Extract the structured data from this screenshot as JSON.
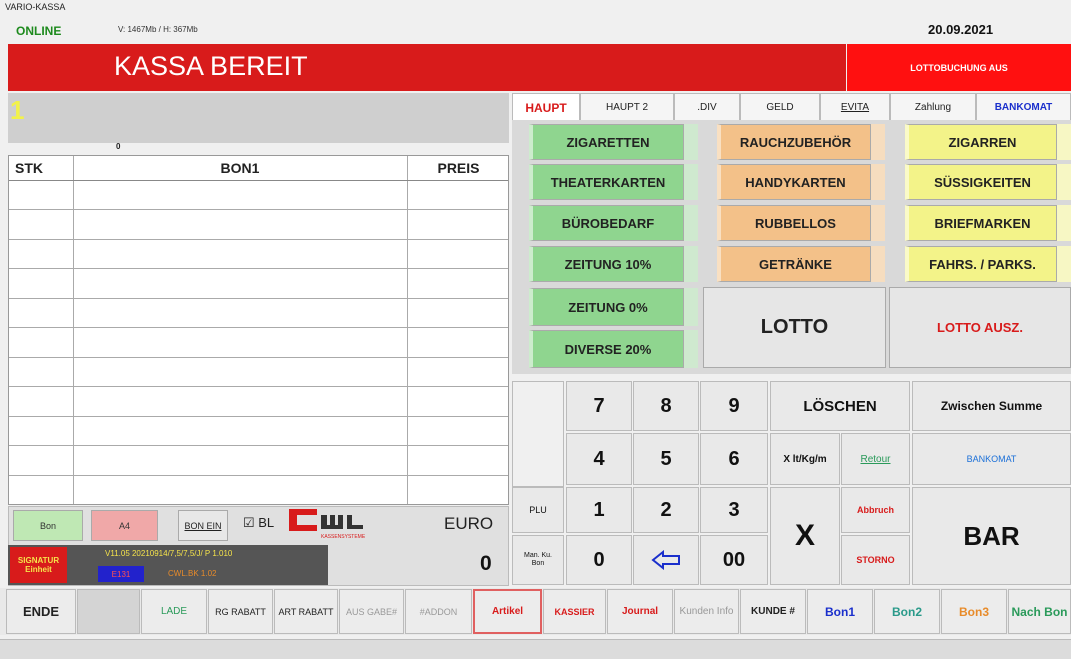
{
  "header": {
    "app_title": "VARIO-KASSA",
    "status": "ONLINE",
    "memory": "V: 1467Mb / H: 367Mb",
    "date": "20.09.2021"
  },
  "banner": {
    "text": "KASSA BEREIT",
    "lotto_status": "LOTTOBUCHUNG AUS"
  },
  "left": {
    "position_number": "1",
    "small_count": "0",
    "columns": [
      "STK",
      "BON1",
      "PREIS"
    ],
    "currency": "EURO",
    "total": "0",
    "bon_label": "Bon",
    "a4_label": "A4",
    "bon_ein_label": "BON EIN",
    "bl_label": "☑ BL",
    "signatur_line1": "SIGNATUR",
    "signatur_line2": "Einheit",
    "version": "V11.05 20210914/7,5/7,5/J/ P 1.010",
    "e_code": "E131",
    "cwl_bk": "CWL.BK 1.02",
    "logo_sub": "KASSENSYSTEME"
  },
  "tabs": [
    {
      "label": "HAUPT"
    },
    {
      "label": "HAUPT 2"
    },
    {
      "label": ".DIV"
    },
    {
      "label": "GELD"
    },
    {
      "label": "EVITA"
    },
    {
      "label": "Zahlung"
    },
    {
      "label": "BANKOMAT"
    }
  ],
  "categories": {
    "zigaretten": "ZIGARETTEN",
    "rauchzubehoer": "RAUCHZUBEHÖR",
    "zigarren": "ZIGARREN",
    "theaterkarten": "THEATERKARTEN",
    "handykarten": "HANDYKARTEN",
    "suessigkeiten": "SÜSSIGKEITEN",
    "buerobedarf": "BÜROBEDARF",
    "rubbellos": "RUBBELLOS",
    "briefmarken": "BRIEFMARKEN",
    "zeitung10": "ZEITUNG 10%",
    "getraenke": "GETRÄNKE",
    "fahrs": "FAHRS. / PARKS.",
    "zeitung0": "ZEITUNG 0%",
    "diverse20": "DIVERSE 20%",
    "lotto": "LOTTO",
    "lotto_ausz": "LOTTO AUSZ."
  },
  "keypad": {
    "k7": "7",
    "k8": "8",
    "k9": "9",
    "k4": "4",
    "k5": "5",
    "k6": "6",
    "k1": "1",
    "k2": "2",
    "k3": "3",
    "k0": "0",
    "k00": "00",
    "loeschen": "LÖSCHEN",
    "zwischen_summe": "Zwischen Summe",
    "x_unit": "X lt/Kg/m",
    "retour": "Retour",
    "bankomat": "BANKOMAT",
    "plu": "PLU",
    "abbruch": "Abbruch",
    "x": "X",
    "bar": "BAR",
    "man_ku_bon": "Man. Ku. Bon",
    "storno": "STORNO"
  },
  "bottom": {
    "ende": "ENDE",
    "lade": "LADE",
    "rg_rabatt": "RG RABATT",
    "art_rabatt": "ART RABATT",
    "aus_gabe": "AUS GABE#",
    "addon": "#ADDON",
    "artikel": "Artikel",
    "kassier": "KASSIER",
    "journal": "Journal",
    "kunden_info": "Kunden Info",
    "kunde": "KUNDE #",
    "bon1": "Bon1",
    "bon2": "Bon2",
    "bon3": "Bon3",
    "nach_bon": "Nach Bon"
  },
  "colors": {
    "banner_red": "#d81b1b",
    "green_cat": "#8fd58f",
    "orange_cat": "#f3c189",
    "yellow_cat": "#f3f389",
    "online_green": "#1d8a1d"
  }
}
